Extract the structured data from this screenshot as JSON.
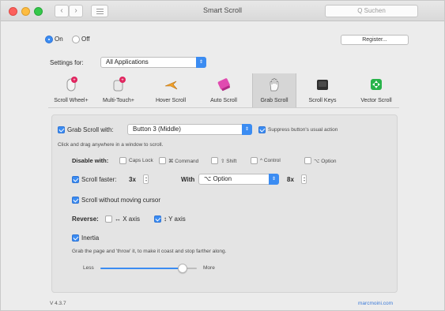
{
  "window": {
    "title": "Smart Scroll"
  },
  "search": {
    "placeholder": "Q Suchen"
  },
  "nav": {
    "back": "‹",
    "forward": "›"
  },
  "power": {
    "on_label": "On",
    "off_label": "Off",
    "selected": "On"
  },
  "register_label": "Register...",
  "settings_for": {
    "label": "Settings for:",
    "value": "All Applications"
  },
  "tabs": [
    {
      "label": "Scroll Wheel+",
      "icon": "scroll-wheel-icon"
    },
    {
      "label": "Multi-Touch+",
      "icon": "multi-touch-icon"
    },
    {
      "label": "Hover Scroll",
      "icon": "hover-scroll-icon"
    },
    {
      "label": "Auto Scroll",
      "icon": "auto-scroll-icon"
    },
    {
      "label": "Grab Scroll",
      "icon": "hand-icon",
      "selected": true
    },
    {
      "label": "Scroll Keys",
      "icon": "keyboard-icon"
    },
    {
      "label": "Vector Scroll",
      "icon": "vector-scroll-icon"
    }
  ],
  "grab": {
    "enable_label": "Grab Scroll with:",
    "button_value": "Button 3 (Middle)",
    "suppress_label": "Suppress button's usual action",
    "hint": "Click and drag anywhere in a window to scroll."
  },
  "disable": {
    "label": "Disable with:",
    "options": [
      "Caps Lock",
      "⌘ Command",
      "⇧ Shift",
      "^ Control",
      "⌥ Option"
    ]
  },
  "faster": {
    "label": "Scroll faster:",
    "factor": "3x",
    "with_label": "With",
    "modifier": "⌥ Option",
    "factor2": "8x"
  },
  "no_cursor_label": "Scroll without moving cursor",
  "reverse": {
    "label": "Reverse:",
    "x_label": "↔ X axis",
    "y_label": "↕ Y axis"
  },
  "inertia": {
    "label": "Inertia",
    "hint": "Grab the page and 'throw' it, to make it coast and stop farther along.",
    "less": "Less",
    "more": "More",
    "level": 0.85
  },
  "footer": {
    "version": "V 4.3.7",
    "link": "marcmoini.com"
  },
  "colors": {
    "accent": "#3b8cf2"
  }
}
